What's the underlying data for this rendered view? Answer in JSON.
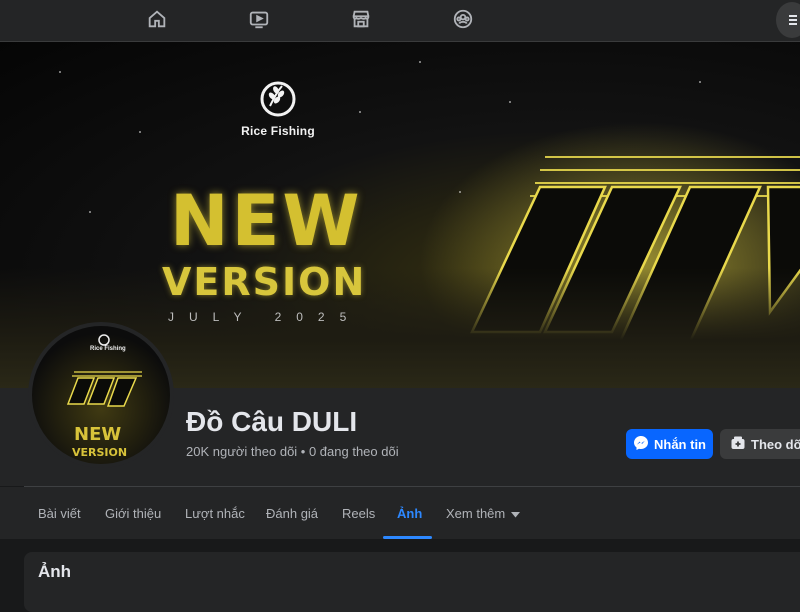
{
  "nav": {
    "icons": [
      "home-icon",
      "video-icon",
      "marketplace-icon",
      "groups-icon",
      "menu-icon"
    ]
  },
  "cover": {
    "brand": "Rice Fishing",
    "headline_1": "NEW",
    "headline_2": "VERSION",
    "subline": "JULY 2025"
  },
  "avatar": {
    "brand": "Rice Fishing",
    "headline_1": "NEW",
    "headline_2": "VERSION"
  },
  "profile": {
    "name": "Đồ Câu DULI",
    "stats": "20K người theo dõi • 0 đang theo dõi",
    "message_label": "Nhắn tin",
    "follow_label": "Theo dõi"
  },
  "tabs": [
    {
      "label": "Bài viết"
    },
    {
      "label": "Giới thiệu"
    },
    {
      "label": "Lượt nhắc"
    },
    {
      "label": "Đánh giá"
    },
    {
      "label": "Reels"
    },
    {
      "label": "Ảnh"
    },
    {
      "label": "Xem thêm"
    }
  ],
  "section": {
    "title": "Ảnh"
  },
  "colors": {
    "background": "#18191a",
    "surface": "#242526",
    "accent": "#0866ff",
    "active_tab": "#2d88ff",
    "gold": "#d4c030"
  }
}
